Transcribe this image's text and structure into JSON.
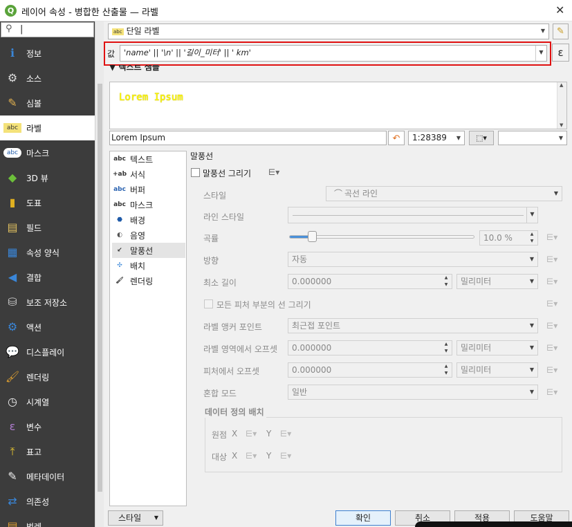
{
  "window": {
    "title": "레이어 속성 - 병합한 산출물 — 라벨",
    "close": "✕"
  },
  "sidebar": {
    "search_placeholder": "",
    "items": [
      {
        "label": "정보",
        "icon": "info-icon"
      },
      {
        "label": "소스",
        "icon": "source-icon"
      },
      {
        "label": "심볼",
        "icon": "symbology-icon"
      },
      {
        "label": "라벨",
        "icon": "labels-icon"
      },
      {
        "label": "마스크",
        "icon": "mask-icon"
      },
      {
        "label": "3D 뷰",
        "icon": "3d-view-icon"
      },
      {
        "label": "도표",
        "icon": "diagrams-icon"
      },
      {
        "label": "필드",
        "icon": "fields-icon"
      },
      {
        "label": "속성 양식",
        "icon": "attributes-form-icon"
      },
      {
        "label": "결합",
        "icon": "joins-icon"
      },
      {
        "label": "보조 저장소",
        "icon": "auxiliary-storage-icon"
      },
      {
        "label": "액션",
        "icon": "actions-icon"
      },
      {
        "label": "디스플레이",
        "icon": "display-icon"
      },
      {
        "label": "렌더링",
        "icon": "rendering-icon"
      },
      {
        "label": "시계열",
        "icon": "temporal-icon"
      },
      {
        "label": "변수",
        "icon": "variables-icon"
      },
      {
        "label": "표고",
        "icon": "elevation-icon"
      },
      {
        "label": "메타데이터",
        "icon": "metadata-icon"
      },
      {
        "label": "의존성",
        "icon": "dependencies-icon"
      },
      {
        "label": "범례",
        "icon": "legend-icon"
      }
    ]
  },
  "labels": {
    "mode": "단일 라벨",
    "value_prefix": "값",
    "expression": "'name' || '\\n' || '길이_미터' || ' km'",
    "text_sample_heading": "텍스트 샘플",
    "sample_text": "Lorem Ipsum",
    "sample_input": "Lorem Ipsum",
    "scale": "1:28389",
    "epsilon": "ε"
  },
  "subtabs": [
    {
      "label": "텍스트",
      "icon": "text-icon"
    },
    {
      "label": "서식",
      "icon": "formatting-icon"
    },
    {
      "label": "버퍼",
      "icon": "buffer-icon"
    },
    {
      "label": "마스크",
      "icon": "mask-icon"
    },
    {
      "label": "배경",
      "icon": "background-icon"
    },
    {
      "label": "음영",
      "icon": "shadow-icon"
    },
    {
      "label": "말풍선",
      "icon": "callout-icon"
    },
    {
      "label": "배치",
      "icon": "placement-icon"
    },
    {
      "label": "렌더링",
      "icon": "rendering-icon"
    }
  ],
  "callout": {
    "heading": "말풍선",
    "draw_label": "말풍선 그리기",
    "style_label": "스타일",
    "style_value": "곡선 라인",
    "line_style_label": "라인 스타일",
    "curvature_label": "곡률",
    "curvature_value": "10.0 %",
    "curvature_fraction": 0.1,
    "orientation_label": "방향",
    "orientation_value": "자동",
    "min_length_label": "최소 길이",
    "min_length_value": "0.000000",
    "min_length_unit": "밀리미터",
    "all_parts_label": "모든 피처 부분의 선 그리기",
    "anchor_label": "라벨 앵커 포인트",
    "anchor_value": "최근접 포인트",
    "offset_label_area_label": "라벨 영역에서 오프셋",
    "offset_label_area_value": "0.000000",
    "offset_label_area_unit": "밀리미터",
    "offset_feature_label": "피처에서 오프셋",
    "offset_feature_value": "0.000000",
    "offset_feature_unit": "밀리미터",
    "blend_label": "혼합 모드",
    "blend_value": "일반",
    "ddp_heading": "데이터 정의 배치",
    "origin_label": "원점",
    "destination_label": "대상",
    "x_label": "X",
    "y_label": "Y"
  },
  "buttons": {
    "style": "스타일",
    "ok": "확인",
    "cancel": "취소",
    "apply": "적용",
    "help": "도움말"
  },
  "colors": {
    "sidebar_bg": "#3c3c3c",
    "sample_text": "#ffff00",
    "highlight": "#e01010"
  }
}
